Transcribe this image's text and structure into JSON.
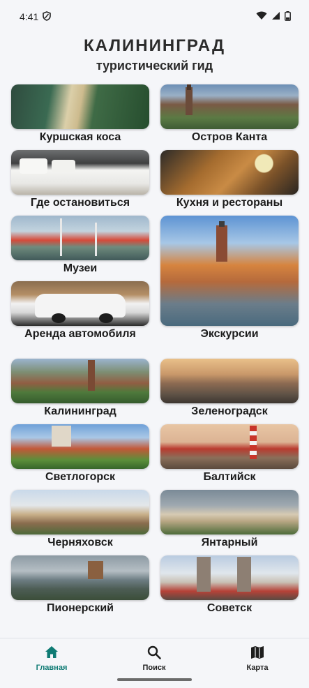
{
  "status": {
    "time": "4:41"
  },
  "header": {
    "title": "КАЛИНИНГРАД",
    "subtitle": "туристический гид"
  },
  "cards": {
    "kurshskaya_kosa": "Куршская коса",
    "ostrov_kanta": "Остров Канта",
    "gde_ostanovitsya": "Где остановиться",
    "kuhnya": "Кухня и рестораны",
    "muzei": "Музеи",
    "ekskursii": "Экскурсии",
    "arenda": "Аренда автомобиля",
    "kaliningrad": "Калининград",
    "zelenogradsk": "Зеленоградск",
    "svetlogorsk": "Светлогорск",
    "baltiysk": "Балтийск",
    "chernyahovsk": "Черняховск",
    "yantarny": "Янтарный",
    "pionersky": "Пионерский",
    "sovetsk": "Советск"
  },
  "nav": {
    "home": "Главная",
    "search": "Поиск",
    "map": "Карта"
  },
  "colors": {
    "accent": "#0f7b74",
    "background": "#f5f6f9"
  }
}
